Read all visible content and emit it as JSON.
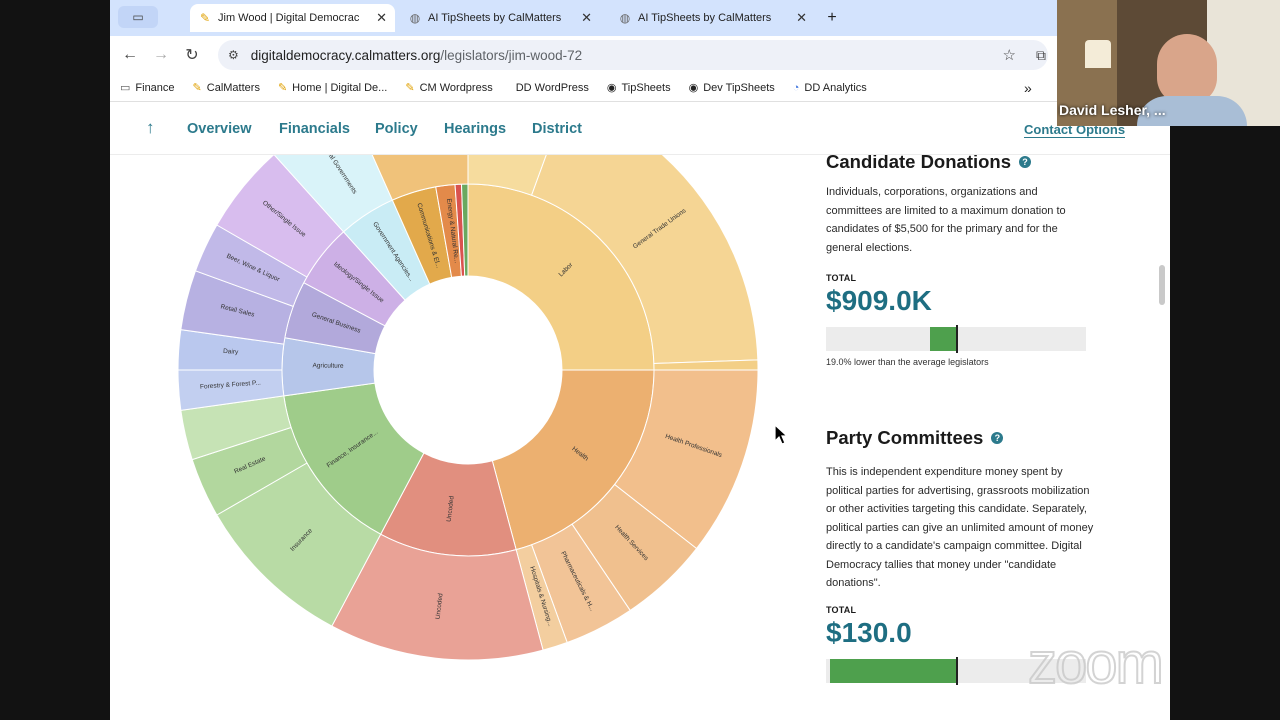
{
  "browser": {
    "tabs": [
      {
        "title": "Jim Wood | Digital Democrac",
        "active": true,
        "icon": "calmatters-feather-icon"
      },
      {
        "title": "AI TipSheets by CalMatters",
        "active": false,
        "icon": "globe-icon"
      },
      {
        "title": "AI TipSheets by CalMatters",
        "active": false,
        "icon": "globe-icon"
      }
    ],
    "new_tab": "+",
    "close_glyph": "✕",
    "url_host": "digitaldemocracy.calmatters.org",
    "url_path": "/legislators/jim-wood-72",
    "bookmarks": [
      {
        "label": "Finance",
        "icon": "folder-icon"
      },
      {
        "label": "CalMatters",
        "icon": "feather-icon"
      },
      {
        "label": "Home | Digital De...",
        "icon": "feather-icon"
      },
      {
        "label": "CM Wordpress",
        "icon": "feather-icon"
      },
      {
        "label": "DD WordPress",
        "icon": "blank-icon"
      },
      {
        "label": "TipSheets",
        "icon": "globe-icon"
      },
      {
        "label": "Dev TipSheets",
        "icon": "globe-icon"
      },
      {
        "label": "DD Analytics",
        "icon": "analytics-icon"
      }
    ],
    "overflow": "»"
  },
  "site_nav": {
    "up_arrow": "↑",
    "items": [
      "Overview",
      "Financials",
      "Policy",
      "Hearings",
      "District"
    ],
    "contact": "Contact Options"
  },
  "sunburst": {
    "inner_labels": [
      "Labor",
      "Health",
      "Uncoded",
      "Finance, Insurance...",
      "Agriculture",
      "General Business",
      "Ideology/Single Issue",
      "Government Agencies...",
      "Communications & El...",
      "Energy & Natural Re...",
      "Transportation"
    ],
    "outer_labels": [
      "Public Se...",
      "General Trade Unions",
      "Health Professionals",
      "Health Services",
      "Pharmaceuticals & H...",
      "Hospitals & Nursing...",
      "Uncoded",
      "Insurance",
      "Real Estate",
      "Forestry & Forest P...",
      "Dairy",
      "Retail Sales",
      "Beer, Wine & Liquor",
      "Other/Single Issue",
      "Tribal Governments"
    ]
  },
  "candidate_donations": {
    "title": "Candidate Donations",
    "help": "?",
    "description": "Individuals, corporations, organizations and committees are limited to a maximum donation to candidates of $5,500 for the primary and for the general elections.",
    "total_label": "TOTAL",
    "total_value": "$909.0K",
    "bar_level": 0.5,
    "comparison": "19.0% lower than the average legislators"
  },
  "party_committees": {
    "title": "Party Committees",
    "help": "?",
    "description": "This is independent expenditure money spent by political parties for advertising, grassroots mobilization or other activities targeting this candidate. Separately, political parties can give an unlimited amount of money directly to a candidate's campaign committee. Digital Democracy tallies that money under \"candidate donations\".",
    "total_label": "TOTAL",
    "total_value": "$130.0"
  },
  "video": {
    "name": "David Lesher, ..."
  },
  "zoom_logo": "zoom",
  "colors": {
    "accent": "#2c7a8c",
    "value": "#1e6e82",
    "bar_green": "#4ea04d"
  }
}
